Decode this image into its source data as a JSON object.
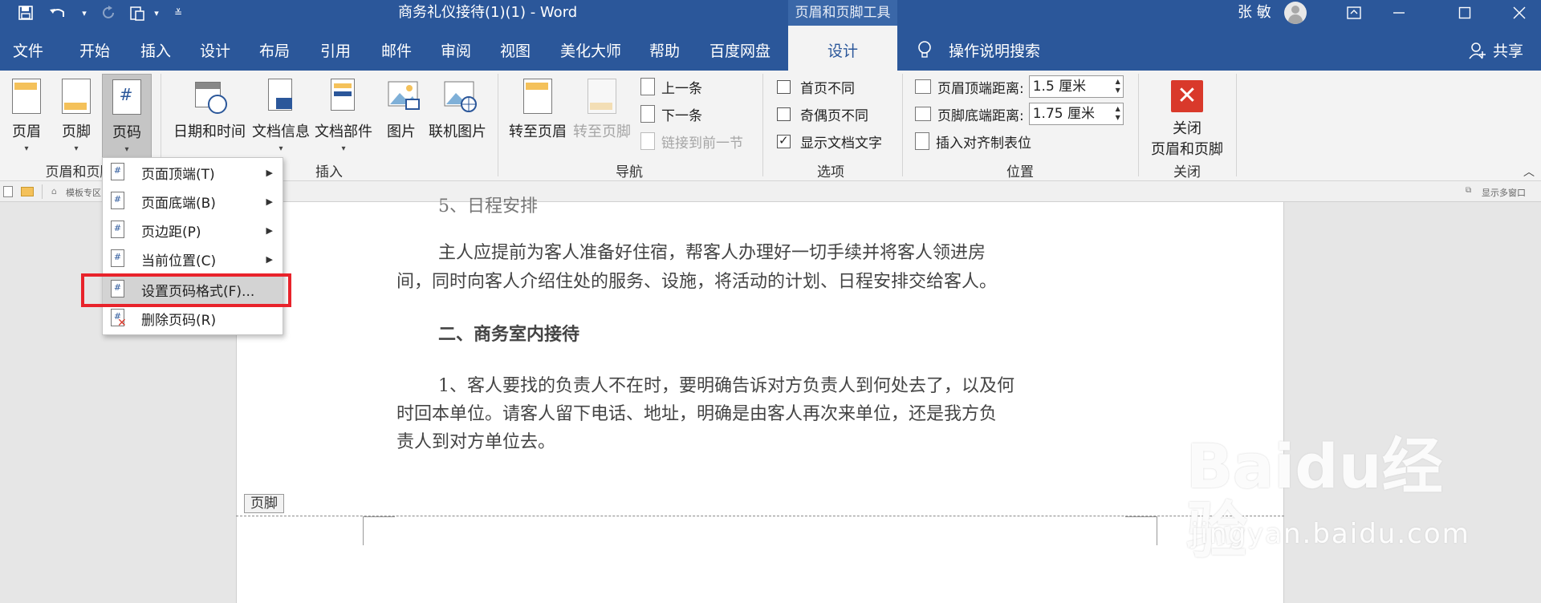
{
  "window": {
    "title": "商务礼仪接待(1)(1)  -  Word",
    "context_tools": "页眉和页脚工具",
    "user": "张 敏"
  },
  "tabs": [
    {
      "label": "文件"
    },
    {
      "label": "开始"
    },
    {
      "label": "插入"
    },
    {
      "label": "设计"
    },
    {
      "label": "布局"
    },
    {
      "label": "引用"
    },
    {
      "label": "邮件"
    },
    {
      "label": "审阅"
    },
    {
      "label": "视图"
    },
    {
      "label": "美化大师"
    },
    {
      "label": "帮助"
    },
    {
      "label": "百度网盘"
    },
    {
      "label": "设计",
      "active": true
    }
  ],
  "search": {
    "label": "操作说明搜索"
  },
  "share": {
    "label": "共享"
  },
  "ribbon": {
    "hf": {
      "header": "页眉",
      "footer": "页脚",
      "page_num": "页码",
      "group": "页眉和页脚"
    },
    "insert": {
      "datetime": "日期和时间",
      "docinfo": "文档信息",
      "parts": "文档部件",
      "picture": "图片",
      "online_picture": "联机图片",
      "group": "插入"
    },
    "nav": {
      "goto_header": "转至页眉",
      "goto_footer": "转至页脚",
      "prev": "上一条",
      "next": "下一条",
      "link_prev": "链接到前一节",
      "group": "导航"
    },
    "options": {
      "diff_first": "首页不同",
      "diff_odd_even": "奇偶页不同",
      "show_doc_text": "显示文档文字",
      "group": "选项"
    },
    "position": {
      "header_dist_label": "页眉顶端距离:",
      "header_dist_value": "1.5 厘米",
      "footer_dist_label": "页脚底端距离:",
      "footer_dist_value": "1.75 厘米",
      "align_tab": "插入对齐制表位",
      "group": "位置"
    },
    "close": {
      "line1": "关闭",
      "line2": "页眉和页脚",
      "group": "关闭"
    }
  },
  "quickbar": {
    "tab": "模板专区",
    "right": "显示多窗口"
  },
  "menu": {
    "items": [
      {
        "label": "页面顶端(T)",
        "submenu": true
      },
      {
        "label": "页面底端(B)",
        "submenu": true
      },
      {
        "label": "页边距(P)",
        "submenu": true
      },
      {
        "label": "当前位置(C)",
        "submenu": true
      },
      {
        "label": "设置页码格式(F)...",
        "submenu": false,
        "hover": true
      },
      {
        "label": "删除页码(R)",
        "submenu": false
      }
    ]
  },
  "document": {
    "cut_heading": "5、日程安排",
    "p1_line1": "主人应提前为客人准备好住宿，帮客人办理好一切手续并将客人领进房",
    "p1_line2": "间，同时向客人介绍住处的服务、设施，将活动的计划、日程安排交给客人。",
    "heading2": "二、商务室内接待",
    "p2_line1": "1、客人要找的负责人不在时，要明确告诉对方负责人到何处去了，以及何",
    "p2_line2": "时回本单位。请客人留下电话、地址，明确是由客人再次来单位，还是我方负",
    "p2_line3": "责人到对方单位去。",
    "footer_tag": "页脚"
  },
  "watermark": {
    "brand": "Baidu经验",
    "url": "jingyan.baidu.com"
  },
  "colors": {
    "accent": "#2b579a",
    "highlight": "#e8232b",
    "close": "#d9392b"
  }
}
